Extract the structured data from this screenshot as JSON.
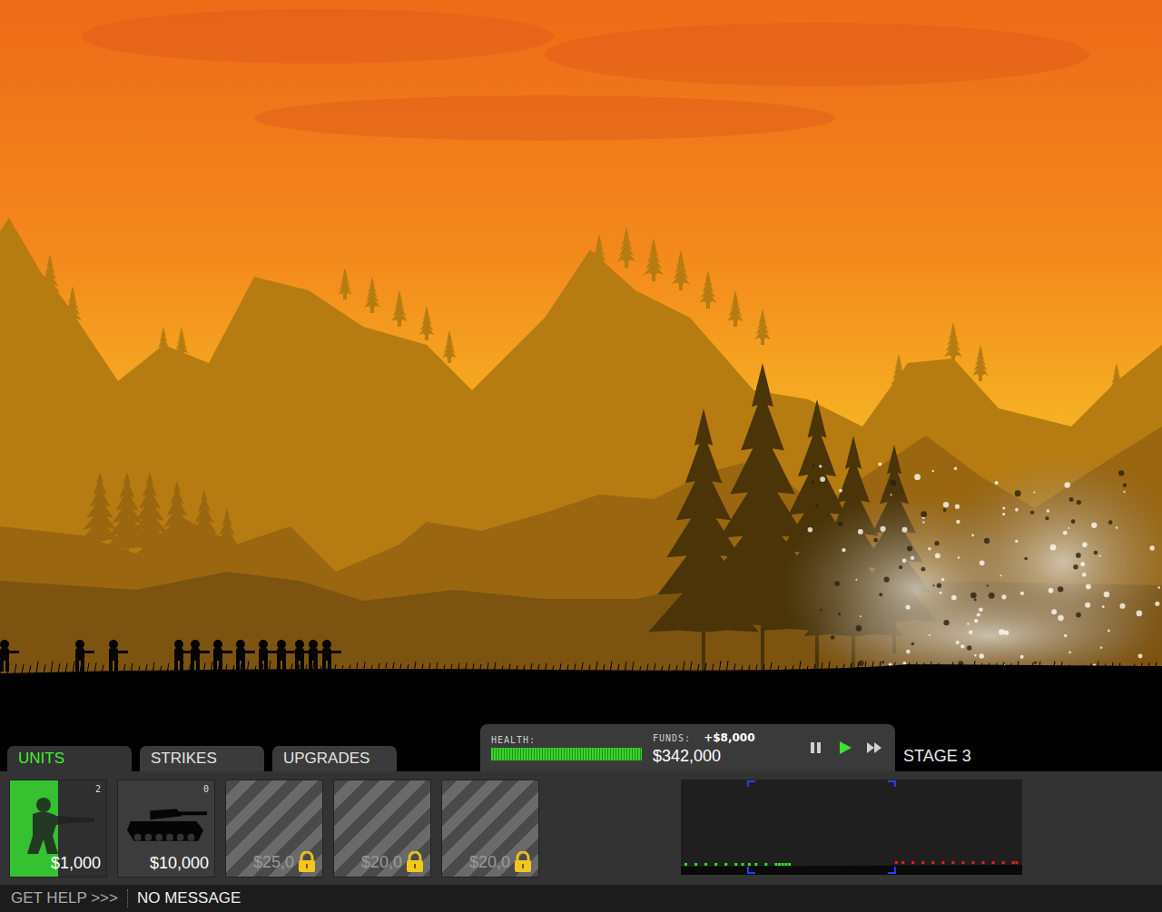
{
  "tabs": [
    {
      "label": "UNITS",
      "selected": true
    },
    {
      "label": "STRIKES",
      "selected": false
    },
    {
      "label": "UPGRADES",
      "selected": false
    }
  ],
  "status": {
    "health_label": "HEALTH:",
    "health": {
      "level": 1
    },
    "funds_label": "FUNDS:",
    "income": "+$8,000",
    "funds": "$342,000",
    "controls": [
      {
        "kind": "pause",
        "selected": false
      },
      {
        "kind": "play",
        "selected": true
      },
      {
        "kind": "fast",
        "selected": false
      }
    ]
  },
  "stage": "STAGE 3",
  "units": [
    {
      "kind": "soldier",
      "price": "$1,000",
      "count": "2",
      "selected": true,
      "locked": false
    },
    {
      "kind": "tank",
      "price": "$10,000",
      "count": "0",
      "selected": false,
      "locked": false
    },
    {
      "kind": "locked",
      "price": "$25,0",
      "selected": false,
      "locked": true
    },
    {
      "kind": "locked",
      "price": "$20,0",
      "selected": false,
      "locked": true
    },
    {
      "kind": "locked",
      "price": "$20,0",
      "selected": false,
      "locked": true
    }
  ],
  "minimap": {
    "viewport": {
      "start": 0.19,
      "end": 0.63
    },
    "friendly": [
      0.0,
      0.03,
      0.06,
      0.09,
      0.12,
      0.15,
      0.17,
      0.19,
      0.21,
      0.24,
      0.27,
      0.28,
      0.29,
      0.3,
      0.31
    ],
    "enemy": [
      0.63,
      0.65,
      0.68,
      0.71,
      0.74,
      0.77,
      0.8,
      0.83,
      0.86,
      0.89,
      0.92,
      0.95,
      0.98,
      0.99
    ]
  },
  "footer": {
    "help": "GET HELP >>>",
    "message": "NO MESSAGE"
  }
}
